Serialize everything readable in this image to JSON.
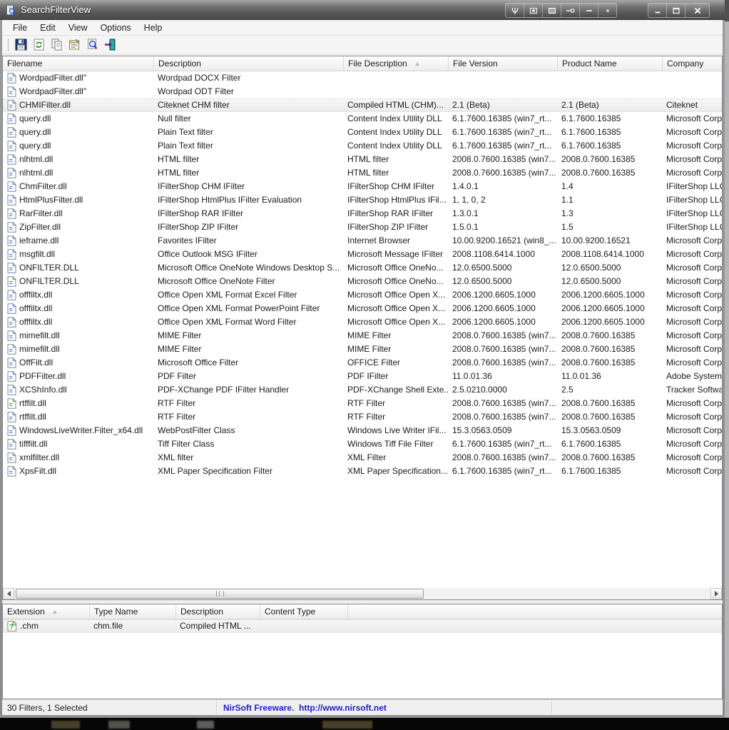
{
  "window": {
    "title": "SearchFilterView"
  },
  "titlebar": {
    "app_icon": "magnifier-document",
    "custom_buttons": [
      "wrench",
      "restore-box",
      "shade-box",
      "pin",
      "minimize-alt",
      "tray-box"
    ],
    "window_buttons": [
      "minimize",
      "maximize",
      "close"
    ]
  },
  "menu": {
    "items": [
      {
        "label": "File"
      },
      {
        "label": "Edit"
      },
      {
        "label": "View"
      },
      {
        "label": "Options"
      },
      {
        "label": "Help"
      }
    ]
  },
  "toolbar": {
    "buttons": [
      "save",
      "refresh",
      "copy",
      "properties",
      "find",
      "exit"
    ]
  },
  "main_table": {
    "columns": [
      {
        "label": "Filename",
        "sorted": false
      },
      {
        "label": "Description",
        "sorted": false
      },
      {
        "label": "File Description",
        "sorted": true
      },
      {
        "label": "File Version",
        "sorted": false
      },
      {
        "label": "Product Name",
        "sorted": false
      },
      {
        "label": "Company",
        "sorted": false
      }
    ],
    "selected_index": 2,
    "rows": [
      {
        "filename": "WordpadFilter.dll\"",
        "description": "Wordpad DOCX Filter",
        "file_description": "",
        "file_version": "",
        "product_name": "",
        "company": ""
      },
      {
        "filename": "WordpadFilter.dll\"",
        "description": "Wordpad ODT Filter",
        "file_description": "",
        "file_version": "",
        "product_name": "",
        "company": ""
      },
      {
        "filename": "CHMIFilter.dll",
        "description": "Citeknet CHM filter",
        "file_description": "Compiled HTML (CHM)...",
        "file_version": "2.1 (Beta)",
        "product_name": "2.1 (Beta)",
        "company": "Citeknet"
      },
      {
        "filename": "query.dll",
        "description": "Null filter",
        "file_description": "Content Index Utility DLL",
        "file_version": "6.1.7600.16385 (win7_rt...",
        "product_name": "6.1.7600.16385",
        "company": "Microsoft Corp"
      },
      {
        "filename": "query.dll",
        "description": "Plain Text filter",
        "file_description": "Content Index Utility DLL",
        "file_version": "6.1.7600.16385 (win7_rt...",
        "product_name": "6.1.7600.16385",
        "company": "Microsoft Corp"
      },
      {
        "filename": "query.dll",
        "description": "Plain Text filter",
        "file_description": "Content Index Utility DLL",
        "file_version": "6.1.7600.16385 (win7_rt...",
        "product_name": "6.1.7600.16385",
        "company": "Microsoft Corp"
      },
      {
        "filename": "nlhtml.dll",
        "description": "HTML filter",
        "file_description": "HTML filter",
        "file_version": "2008.0.7600.16385 (win7...",
        "product_name": "2008.0.7600.16385",
        "company": "Microsoft Corp"
      },
      {
        "filename": "nlhtml.dll",
        "description": "HTML filter",
        "file_description": "HTML filter",
        "file_version": "2008.0.7600.16385 (win7...",
        "product_name": "2008.0.7600.16385",
        "company": "Microsoft Corp"
      },
      {
        "filename": "ChmFilter.dll",
        "description": "IFilterShop CHM IFilter",
        "file_description": "IFilterShop CHM IFilter",
        "file_version": "1.4.0.1",
        "product_name": "1.4",
        "company": "IFilterShop LLC"
      },
      {
        "filename": "HtmlPlusFilter.dll",
        "description": "IFilterShop HtmlPlus IFilter Evaluation",
        "file_description": "IFilterShop HtmlPlus IFil...",
        "file_version": "1, 1, 0, 2",
        "product_name": "1.1",
        "company": "IFilterShop LLC"
      },
      {
        "filename": "RarFilter.dll",
        "description": "IFilterShop RAR IFilter",
        "file_description": "IFilterShop RAR IFilter",
        "file_version": "1.3.0.1",
        "product_name": "1.3",
        "company": "IFilterShop LLC"
      },
      {
        "filename": "ZipFilter.dll",
        "description": "IFilterShop ZIP IFilter",
        "file_description": "IFilterShop ZIP IFilter",
        "file_version": "1.5.0.1",
        "product_name": "1.5",
        "company": "IFilterShop LLC"
      },
      {
        "filename": "ieframe.dll",
        "description": "Favorites IFilter",
        "file_description": "Internet Browser",
        "file_version": "10.00.9200.16521 (win8_...",
        "product_name": "10.00.9200.16521",
        "company": "Microsoft Corp"
      },
      {
        "filename": "msgfilt.dll",
        "description": "Office Outlook MSG IFilter",
        "file_description": "Microsoft Message IFilter",
        "file_version": "2008.1108.6414.1000",
        "product_name": "2008.1108.6414.1000",
        "company": "Microsoft Corp"
      },
      {
        "filename": "ONFILTER.DLL",
        "description": "Microsoft Office OneNote Windows Desktop S...",
        "file_description": "Microsoft Office OneNo...",
        "file_version": "12.0.6500.5000",
        "product_name": "12.0.6500.5000",
        "company": "Microsoft Corp"
      },
      {
        "filename": "ONFILTER.DLL",
        "description": "Microsoft Office OneNote Filter",
        "file_description": "Microsoft Office OneNo...",
        "file_version": "12.0.6500.5000",
        "product_name": "12.0.6500.5000",
        "company": "Microsoft Corp"
      },
      {
        "filename": "offfiltx.dll",
        "description": "Office Open XML Format Excel Filter",
        "file_description": "Microsoft Office Open X...",
        "file_version": "2006.1200.6605.1000",
        "product_name": "2006.1200.6605.1000",
        "company": "Microsoft Corp"
      },
      {
        "filename": "offfiltx.dll",
        "description": "Office Open XML Format PowerPoint Filter",
        "file_description": "Microsoft Office Open X...",
        "file_version": "2006.1200.6605.1000",
        "product_name": "2006.1200.6605.1000",
        "company": "Microsoft Corp"
      },
      {
        "filename": "offfiltx.dll",
        "description": "Office Open XML Format Word Filter",
        "file_description": "Microsoft Office Open X...",
        "file_version": "2006.1200.6605.1000",
        "product_name": "2006.1200.6605.1000",
        "company": "Microsoft Corp"
      },
      {
        "filename": "mimefilt.dll",
        "description": "MIME Filter",
        "file_description": "MIME Filter",
        "file_version": "2008.0.7600.16385 (win7...",
        "product_name": "2008.0.7600.16385",
        "company": "Microsoft Corp"
      },
      {
        "filename": "mimefilt.dll",
        "description": "MIME Filter",
        "file_description": "MIME Filter",
        "file_version": "2008.0.7600.16385 (win7...",
        "product_name": "2008.0.7600.16385",
        "company": "Microsoft Corp"
      },
      {
        "filename": "OffFilt.dll",
        "description": "Microsoft Office Filter",
        "file_description": "OFFICE Filter",
        "file_version": "2008.0.7600.16385 (win7...",
        "product_name": "2008.0.7600.16385",
        "company": "Microsoft Corp"
      },
      {
        "filename": "PDFFilter.dll",
        "description": "PDF Filter",
        "file_description": "PDF IFilter",
        "file_version": "11.0.01.36",
        "product_name": "11.0.01.36",
        "company": "Adobe Systems"
      },
      {
        "filename": "XCShInfo.dll",
        "description": "PDF-XChange PDF IFilter Handler",
        "file_description": "PDF-XChange Shell Exte...",
        "file_version": "2.5.0210.0000",
        "product_name": "2.5",
        "company": "Tracker Softwa"
      },
      {
        "filename": "rtffilt.dll",
        "description": "RTF Filter",
        "file_description": "RTF Filter",
        "file_version": "2008.0.7600.16385 (win7...",
        "product_name": "2008.0.7600.16385",
        "company": "Microsoft Corp"
      },
      {
        "filename": "rtffilt.dll",
        "description": "RTF Filter",
        "file_description": "RTF Filter",
        "file_version": "2008.0.7600.16385 (win7...",
        "product_name": "2008.0.7600.16385",
        "company": "Microsoft Corp"
      },
      {
        "filename": "WindowsLiveWriter.Filter_x64.dll",
        "description": "WebPostFilter Class",
        "file_description": "Windows Live Writer IFil...",
        "file_version": "15.3.0563.0509",
        "product_name": "15.3.0563.0509",
        "company": "Microsoft Corp"
      },
      {
        "filename": "tifffilt.dll",
        "description": "Tiff Filter Class",
        "file_description": "Windows Tiff File Filter",
        "file_version": "6.1.7600.16385 (win7_rt...",
        "product_name": "6.1.7600.16385",
        "company": "Microsoft Corp"
      },
      {
        "filename": "xmlfilter.dll",
        "description": "XML filter",
        "file_description": "XML Filter",
        "file_version": "2008.0.7600.16385 (win7...",
        "product_name": "2008.0.7600.16385",
        "company": "Microsoft Corp"
      },
      {
        "filename": "XpsFilt.dll",
        "description": "XML Paper Specification Filter",
        "file_description": "XML Paper Specification...",
        "file_version": "6.1.7600.16385 (win7_rt...",
        "product_name": "6.1.7600.16385",
        "company": "Microsoft Corp"
      }
    ]
  },
  "lower_table": {
    "columns": [
      {
        "label": "Extension",
        "sorted": true
      },
      {
        "label": "Type Name",
        "sorted": false
      },
      {
        "label": "Description",
        "sorted": false
      },
      {
        "label": "Content Type",
        "sorted": false
      }
    ],
    "selected_index": 0,
    "rows": [
      {
        "extension": ".chm",
        "type_name": "chm.file",
        "description": "Compiled HTML ...",
        "content_type": ""
      }
    ]
  },
  "status_bar": {
    "left": "30 Filters, 1 Selected",
    "center": "NirSoft Freeware.  http://www.nirsoft.net"
  },
  "colors": {
    "status_link": "#2121c8",
    "titlebar_text": "#ffffff",
    "selection_bg": "#ececec"
  }
}
